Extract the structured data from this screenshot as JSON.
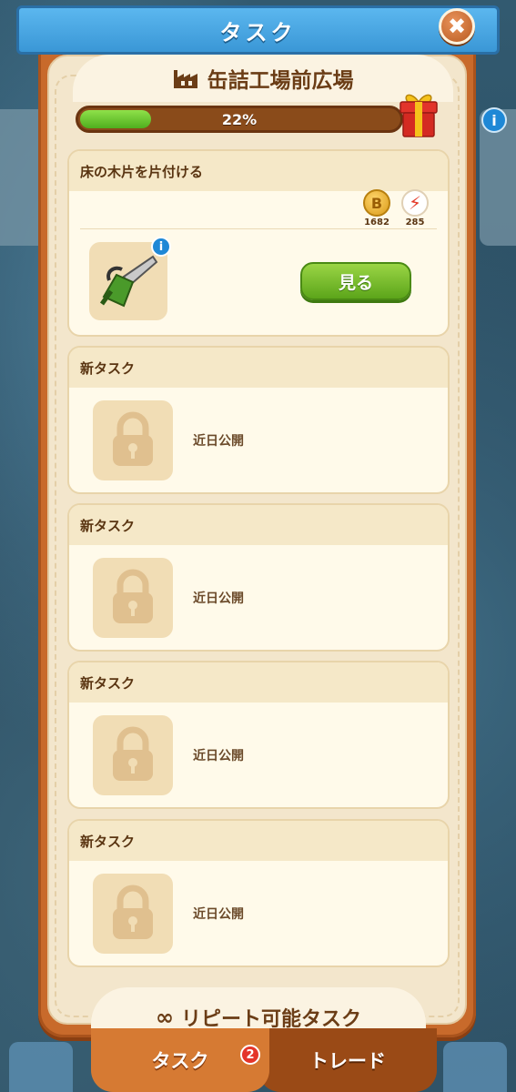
{
  "header": {
    "title": "タスク",
    "close_icon": "close-icon"
  },
  "location": {
    "name": "缶詰工場前広場",
    "icon": "factory-icon"
  },
  "progress": {
    "percent_label": "22%",
    "value": 0.22
  },
  "active_task": {
    "title": "床の木片を片付ける",
    "rewards": [
      {
        "icon": "coin-icon",
        "amount": "1682"
      },
      {
        "icon": "energy-bolt-icon",
        "amount": "285"
      }
    ],
    "item_icon": "chainsaw-icon",
    "info_label": "i",
    "button_label": "見る"
  },
  "locked_tasks": [
    {
      "title": "新タスク",
      "status": "近日公開"
    },
    {
      "title": "新タスク",
      "status": "近日公開"
    },
    {
      "title": "新タスク",
      "status": "近日公開"
    },
    {
      "title": "新タスク",
      "status": "近日公開"
    }
  ],
  "repeat_section": {
    "label": "リピート可能タスク",
    "icon": "infinity-icon"
  },
  "tabs": [
    {
      "label": "タスク",
      "badge": "2"
    },
    {
      "label": "トレード"
    }
  ],
  "background": {
    "info_label": "i"
  },
  "colors": {
    "panel": "#c86a2b",
    "ribbon": "#3a97d6",
    "progress_fill": "#4fae1e",
    "button_green": "#5ca51a"
  }
}
